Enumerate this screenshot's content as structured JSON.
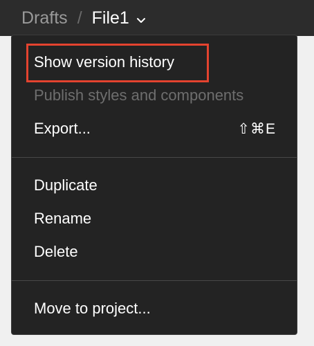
{
  "breadcrumb": {
    "parent": "Drafts",
    "separator": "/",
    "current": "File1"
  },
  "menu": {
    "items": [
      {
        "label": "Show version history",
        "enabled": true
      },
      {
        "label": "Publish styles and components",
        "enabled": false
      },
      {
        "label": "Export...",
        "shortcut": "⇧⌘E",
        "enabled": true
      },
      {
        "label": "Duplicate",
        "enabled": true
      },
      {
        "label": "Rename",
        "enabled": true
      },
      {
        "label": "Delete",
        "enabled": true
      },
      {
        "label": "Move to project...",
        "enabled": true
      }
    ]
  },
  "colors": {
    "titlebar_bg": "#2c2c2c",
    "menu_bg": "#232323",
    "text": "#ffffff",
    "disabled_text": "#6e6e6e",
    "muted_text": "#9a9a9a",
    "divider": "#484848",
    "highlight": "#e4432f"
  }
}
